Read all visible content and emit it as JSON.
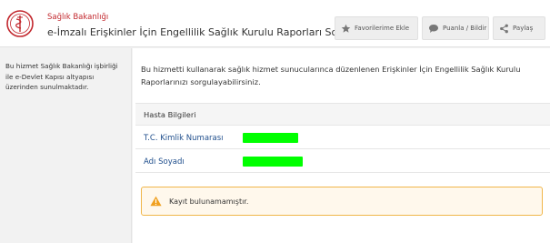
{
  "header": {
    "org_name": "Sağlık Bakanlığı",
    "title": "e-İmzalı Erişkinler İçin Engellilik Sağlık Kurulu Raporları Sorgulama"
  },
  "actions": {
    "favorite_label": "Favorilerime Ekle",
    "rate_label": "Puanla / Bildir",
    "share_label": "Paylaş"
  },
  "sidebar": {
    "text": "Bu hizmet Sağlık Bakanlığı işbirliği ile e-Devlet Kapısı altyapısı üzerinden sunulmaktadır."
  },
  "main": {
    "intro": "Bu hizmetti kullanarak sağlık hizmet sunucularınca düzenlenen Erişkinler İçin Engellilik Sağlık Kurulu Raporlarınızı sorgulayabilirsiniz.",
    "section_title": "Hasta Bilgileri",
    "fields": [
      {
        "label": "T.C. Kimlik Numarası"
      },
      {
        "label": "Adı Soyadı"
      }
    ],
    "alert_text": "Kayıt bulunamamıştır."
  },
  "colors": {
    "brand_red": "#c2272d",
    "label_blue": "#1f4e8c",
    "alert_border": "#f0b64a",
    "redaction_green": "#00ff00"
  },
  "icons": [
    "ministry-logo-icon",
    "star-icon",
    "speech-bubble-icon",
    "share-icon",
    "warning-icon"
  ]
}
